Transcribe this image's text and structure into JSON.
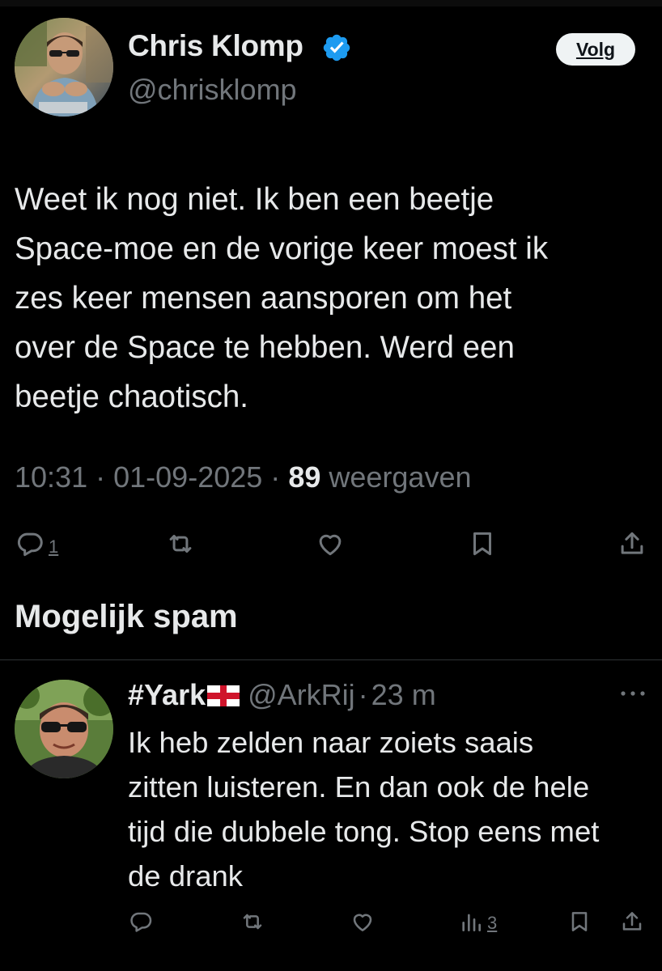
{
  "tweet": {
    "author": {
      "name": "Chris Klomp",
      "handle": "@chrisklomp",
      "verified": true,
      "avatar": "profile-photo-man-sunglasses"
    },
    "follow_label": "Volg",
    "text_lines": [
      "Weet ik nog niet. Ik ben een beetje",
      "Space-moe en de vorige keer moest ik",
      "zes keer mensen aansporen om het",
      "over de Space te hebben. Werd een",
      "beetje chaotisch."
    ],
    "time": "10:31",
    "date": "01-09-2025",
    "separator": "·",
    "view_count": "89",
    "view_label": "weergaven",
    "actions": {
      "reply_count": "1",
      "icons": [
        "reply-icon",
        "retweet-icon",
        "like-icon",
        "bookmark-icon",
        "share-icon"
      ]
    }
  },
  "section": {
    "title": "Mogelijk spam"
  },
  "reply": {
    "author": {
      "name": "#Yark",
      "flag": "england-flag",
      "handle": "@ArkRij",
      "avatar": "profile-photo-man-sunglasses-outdoor"
    },
    "separator": "·",
    "time": "23 m",
    "text_lines": [
      "Ik heb zelden naar zoiets saais",
      "zitten luisteren. En dan ook de hele",
      "tijd die dubbele tong. Stop eens met",
      "de drank"
    ],
    "actions": {
      "view_count": "3",
      "icons": [
        "reply-icon",
        "retweet-icon",
        "like-icon",
        "views-icon",
        "bookmark-icon",
        "share-icon"
      ]
    }
  },
  "colors": {
    "background": "#000000",
    "text_primary": "#e7e9ea",
    "text_secondary": "#71767b",
    "verified_blue": "#1d9bf0",
    "divider": "#2f3336",
    "follow_button_bg": "#eff3f4"
  }
}
